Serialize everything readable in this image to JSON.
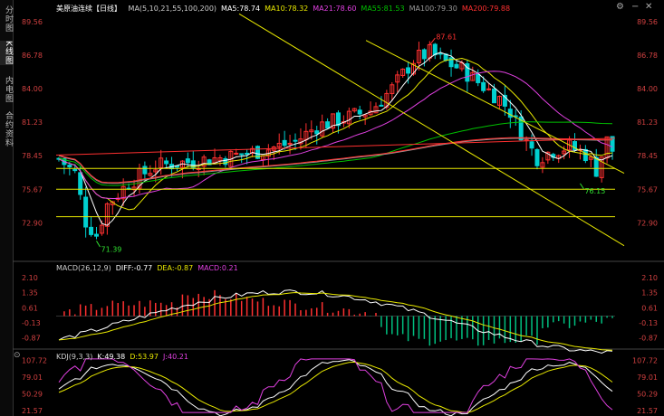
{
  "sidebar": {
    "tabs": [
      {
        "label": "分时图",
        "active": false
      },
      {
        "label": "K线图",
        "active": true
      },
      {
        "label": "内电图",
        "active": false
      },
      {
        "label": "合约资料",
        "active": false
      }
    ]
  },
  "main_panel": {
    "title": "美原油连续",
    "period": "【日线】",
    "ma_items": [
      {
        "label": "MA(5,10,21,55,100,200)",
        "color": "#cccccc"
      },
      {
        "label": "MA5:78.74",
        "color": "#ffffff"
      },
      {
        "label": "MA10:78.32",
        "color": "#e8e800"
      },
      {
        "label": "MA21:78.60",
        "color": "#e040e0"
      },
      {
        "label": "MA55:81.53",
        "color": "#00c000"
      },
      {
        "label": "MA100:79.30",
        "color": "#9a9a9a"
      },
      {
        "label": "MA200:79.88",
        "color": "#ff3030"
      }
    ],
    "y_ticks": [
      "89.56",
      "86.78",
      "84.00",
      "81.23",
      "78.45",
      "75.67",
      "72.90"
    ],
    "high_label": "87.61",
    "low_label": "71.39",
    "recent_low_label": "76.15"
  },
  "macd_panel": {
    "items": [
      {
        "label": "MACD(26,12,9)",
        "color": "#cccccc"
      },
      {
        "label": "DIFF:-0.77",
        "color": "#ffffff"
      },
      {
        "label": "DEA:-0.87",
        "color": "#e8e800"
      },
      {
        "label": "MACD:0.21",
        "color": "#e040e0"
      }
    ],
    "y_ticks": [
      "2.10",
      "1.35",
      "0.61",
      "-0.13",
      "-0.87"
    ]
  },
  "kdj_panel": {
    "items": [
      {
        "label": "KDJ(9,3,3)",
        "color": "#cccccc"
      },
      {
        "label": "K:49.38",
        "color": "#ffffff"
      },
      {
        "label": "D:53.97",
        "color": "#e8e800"
      },
      {
        "label": "J:40.21",
        "color": "#e040e0"
      }
    ],
    "y_ticks": [
      "107.72",
      "79.01",
      "50.29",
      "21.57"
    ]
  },
  "toolbar": {
    "buttons": [
      "settings-gear",
      "minus",
      "close"
    ]
  }
}
